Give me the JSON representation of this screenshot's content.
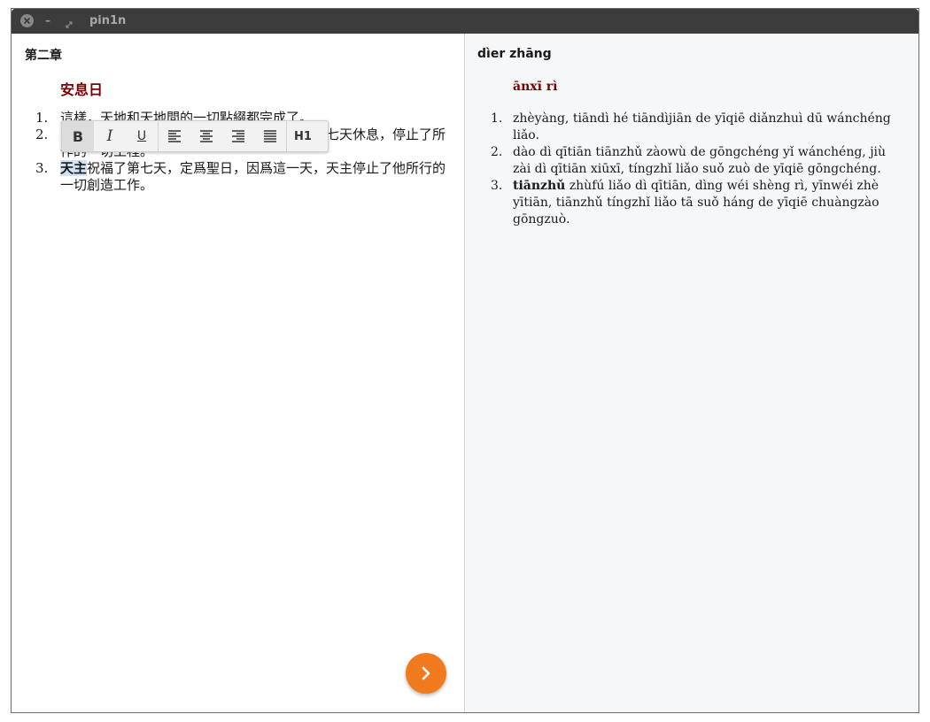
{
  "window": {
    "title": "pin1n"
  },
  "left": {
    "chapter": "第二章",
    "heading": "安息日",
    "items": [
      {
        "num": "1.",
        "text": "這樣，天地和天地間的一切點綴都完成了。"
      },
      {
        "num": "2.",
        "text": "到第七天，天主造物的工程已經完成，就在第七天休息，停止了所作的一切工程。"
      },
      {
        "num": "3.",
        "highlight": "天主",
        "text": "祝福了第七天，定爲聖日，因爲這一天，天主停止了他所行的一切創造工作。"
      }
    ],
    "toolbar": {
      "bold": "B",
      "italic": "I",
      "underline": "U",
      "heading": "H1"
    }
  },
  "right": {
    "chapter": "dìer zhāng",
    "heading": "ānxī rì",
    "items": [
      {
        "num": "1.",
        "text": "zhèyàng, tiāndì hé tiāndìjiān de yīqiē diǎnzhuì dū wánchéng liǎo."
      },
      {
        "num": "2.",
        "text": "dào dì qītiān tiānzhǔ zàowù de gōngchéng yǐ wánchéng, jiù zài dì qītiān xiūxī, tíngzhǐ liǎo suǒ zuò de yīqiē gōngchéng."
      },
      {
        "num": "3.",
        "bold": "tiānzhǔ",
        "text": " zhùfú liǎo dì qītiān, dìng wéi shèng rì, yīnwéi zhè yītiān, tiānzhǔ tíngzhǐ liǎo tā suǒ háng de yīqiē chuàngzào gōngzuò."
      }
    ]
  },
  "colors": {
    "next_button": "#f27a1e",
    "print_button": "#2cb34a",
    "heading": "#7a0000"
  },
  "icons": {
    "close": "close-icon",
    "minimize": "minimize-icon",
    "maximize": "maximize-icon",
    "next": "chevron-right-icon",
    "print": "printer-icon"
  }
}
